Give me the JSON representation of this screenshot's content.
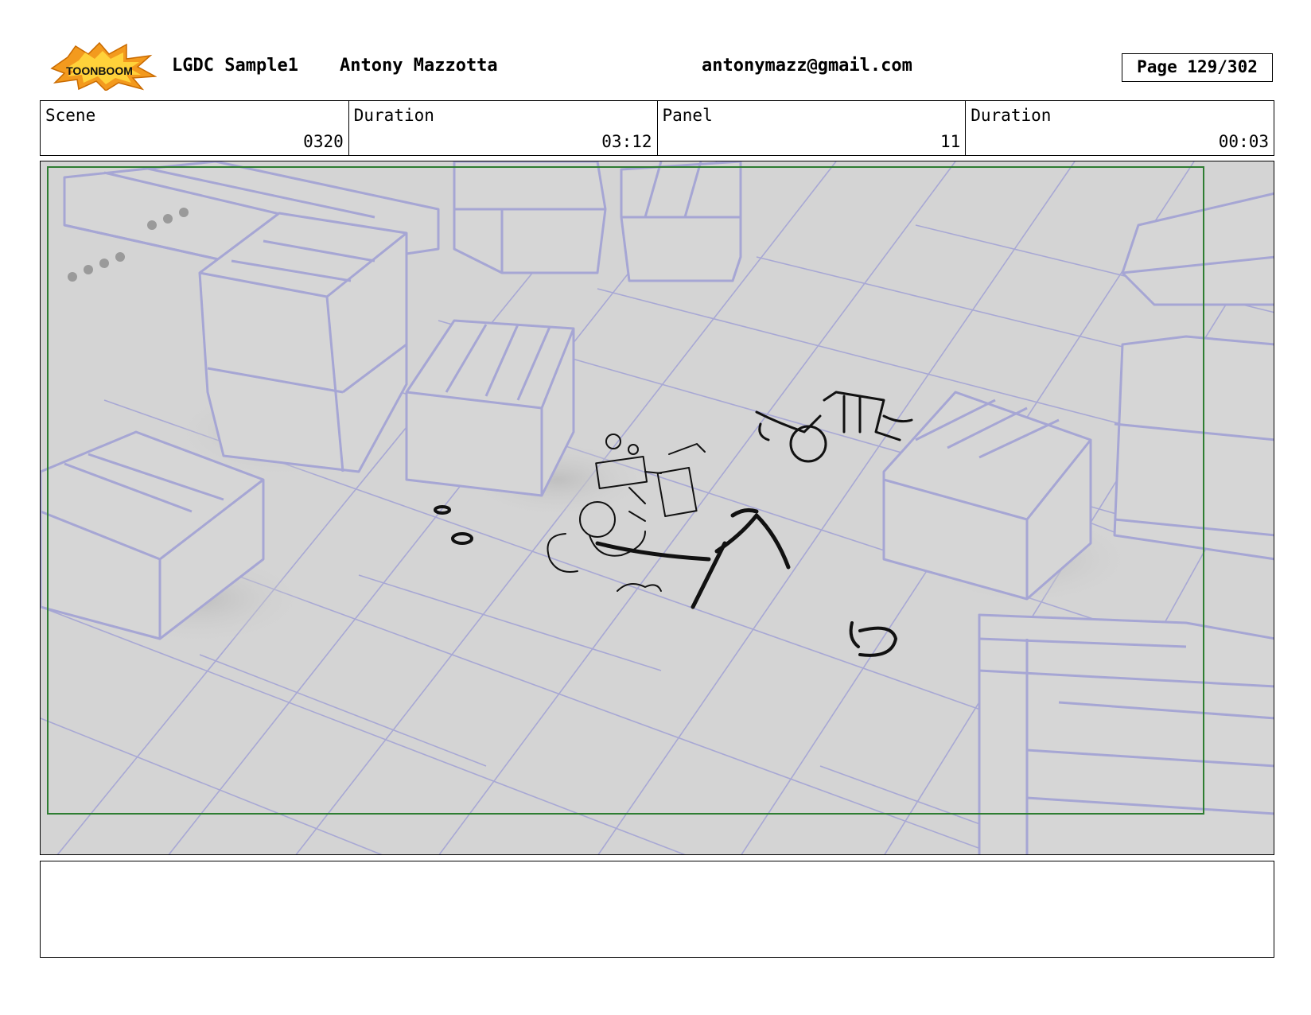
{
  "header": {
    "logo_text": "TOONBOOM",
    "project": "LGDC Sample1",
    "author": "Antony Mazzotta",
    "email": "antonymazz@gmail.com",
    "page": "Page 129/302"
  },
  "info": {
    "scene_label": "Scene",
    "scene_value": "0320",
    "scene_duration_label": "Duration",
    "scene_duration_value": "03:12",
    "panel_label": "Panel",
    "panel_value": "11",
    "panel_duration_label": "Duration",
    "panel_duration_value": "00:03"
  },
  "notes": {
    "text": ""
  },
  "colors": {
    "set_lines": "#a6a6d4",
    "sketch": "#111111",
    "safe_frame": "#2e7d32",
    "frame_bg": "#d4d4d4"
  }
}
